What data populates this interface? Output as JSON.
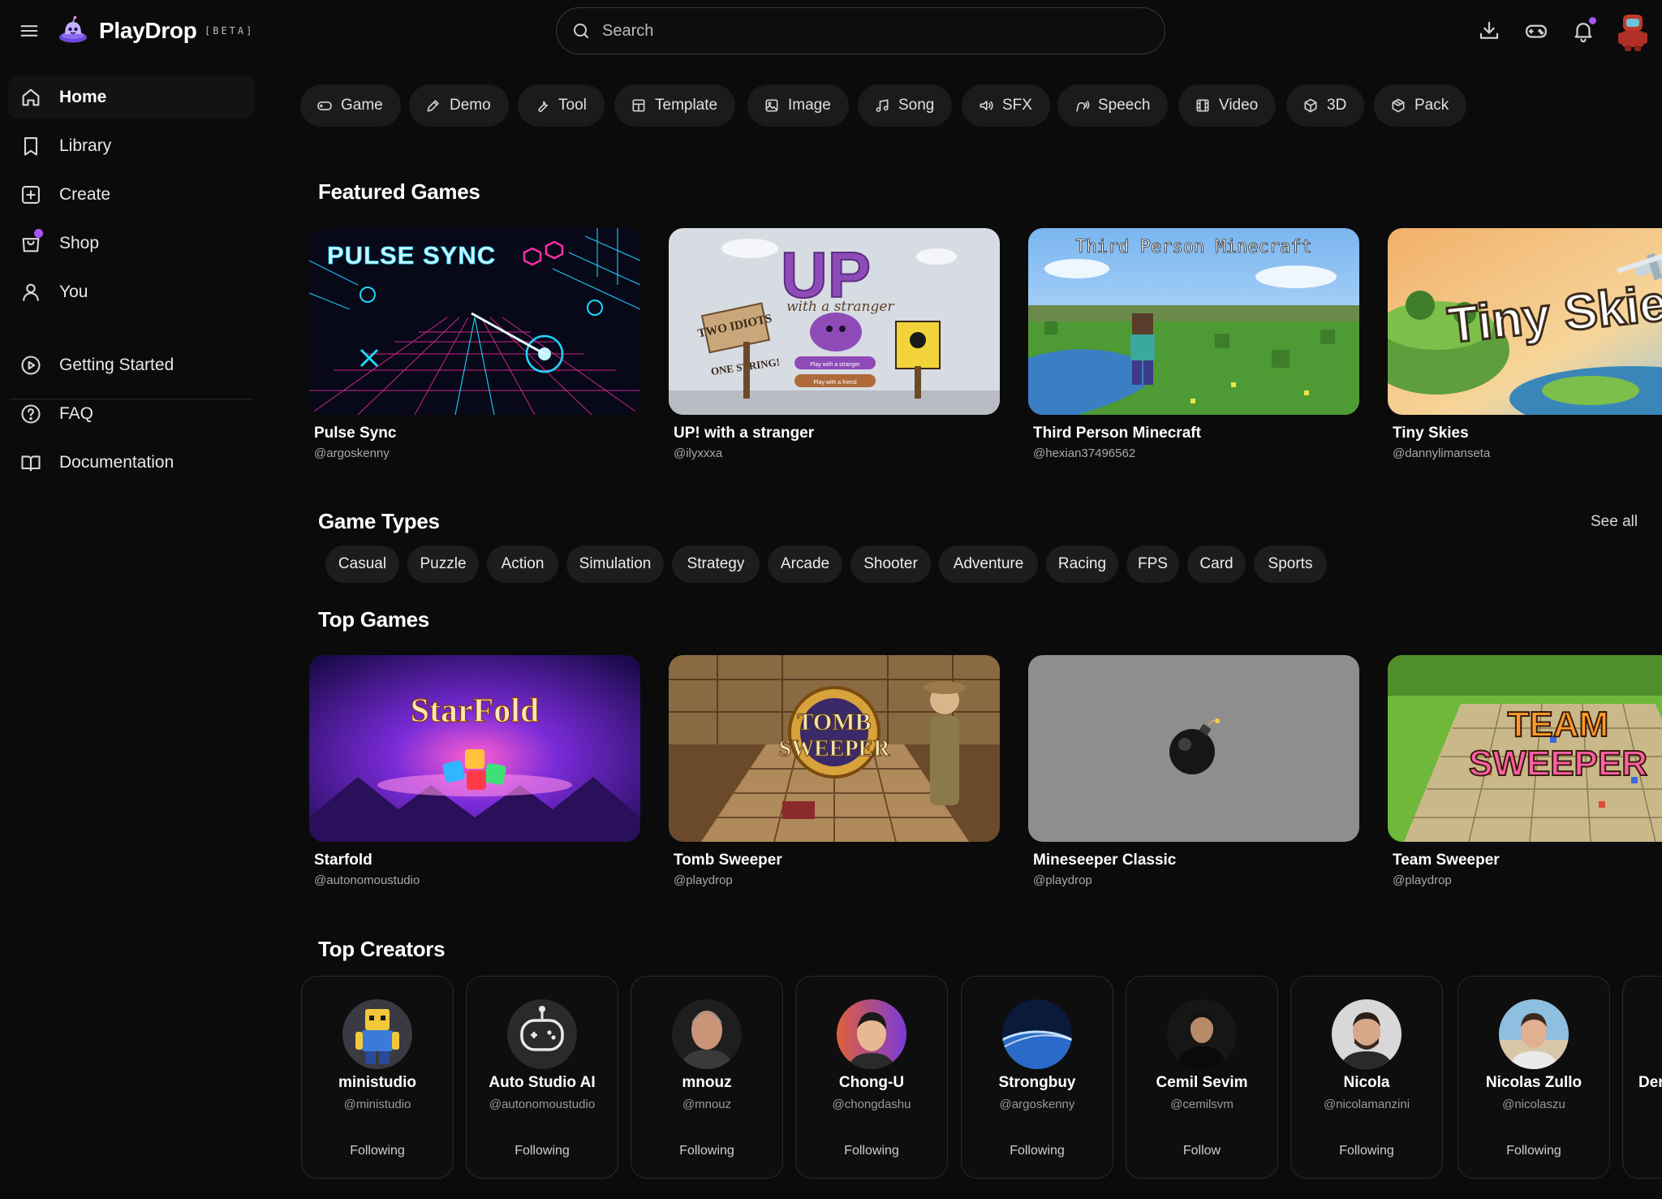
{
  "header": {
    "brand": "PlayDrop",
    "beta_label": "[BETA]",
    "search_placeholder": "Search",
    "icons": [
      "menu-icon",
      "download-icon",
      "gamepad-icon",
      "bell-icon",
      "avatar"
    ],
    "accent_color": "#a855f7"
  },
  "sidebar": {
    "primary": [
      {
        "label": "Home",
        "icon": "home-icon",
        "active": true
      },
      {
        "label": "Library",
        "icon": "bookmark-icon"
      },
      {
        "label": "Create",
        "icon": "plus-square-icon"
      },
      {
        "label": "Shop",
        "icon": "shopping-bag-icon"
      },
      {
        "label": "You",
        "icon": "user-icon"
      }
    ],
    "secondary": [
      {
        "label": "Getting Started",
        "icon": "play-circle-icon"
      },
      {
        "label": "FAQ",
        "icon": "help-circle-icon"
      },
      {
        "label": "Documentation",
        "icon": "book-open-icon"
      }
    ]
  },
  "categories": [
    {
      "label": "Game",
      "icon": "gamepad-icon"
    },
    {
      "label": "Demo",
      "icon": "pen-icon"
    },
    {
      "label": "Tool",
      "icon": "wrench-icon"
    },
    {
      "label": "Template",
      "icon": "layout-icon"
    },
    {
      "label": "Image",
      "icon": "image-icon"
    },
    {
      "label": "Song",
      "icon": "music-icon"
    },
    {
      "label": "SFX",
      "icon": "speaker-icon"
    },
    {
      "label": "Speech",
      "icon": "speech-icon"
    },
    {
      "label": "Video",
      "icon": "film-icon"
    },
    {
      "label": "3D",
      "icon": "cube-icon"
    },
    {
      "label": "Pack",
      "icon": "package-icon"
    }
  ],
  "featured": {
    "title": "Featured Games",
    "games": [
      {
        "title": "Pulse Sync",
        "author": "@argoskenny",
        "art_text": "PULSE SYNC"
      },
      {
        "title": "UP! with a stranger",
        "author": "@ilyxxxa",
        "art_text": "UP",
        "art_subtext": "with a stranger",
        "art_sign_left": "TWO IDIOTS",
        "art_sign_left2": "ONE STRING!",
        "art_btn1": "Play with a stranger",
        "art_btn2": "Play with a friend"
      },
      {
        "title": "Third Person Minecraft",
        "author": "@hexian37496562",
        "art_text": "Third Person Minecraft"
      },
      {
        "title": "Tiny Skies",
        "author": "@dannylimanseta",
        "art_text": "Tiny Skies"
      }
    ]
  },
  "game_types": {
    "title": "Game Types",
    "see_all": "See all",
    "types": [
      "Casual",
      "Puzzle",
      "Action",
      "Simulation",
      "Strategy",
      "Arcade",
      "Shooter",
      "Adventure",
      "Racing",
      "FPS",
      "Card",
      "Sports"
    ]
  },
  "top_games": {
    "title": "Top Games",
    "games": [
      {
        "title": "Starfold",
        "author": "@autonomoustudio",
        "art_text": "StarFold"
      },
      {
        "title": "Tomb Sweeper",
        "author": "@playdrop",
        "art_text": "TOMB",
        "art_text2": "SWEEPER"
      },
      {
        "title": "Mineseeper Classic",
        "author": "@playdrop"
      },
      {
        "title": "Team Sweeper",
        "author": "@playdrop",
        "art_text": "TEAM",
        "art_text2": "SWEEPER"
      }
    ]
  },
  "top_creators": {
    "title": "Top Creators",
    "creators": [
      {
        "name": "ministudio",
        "handle": "@ministudio",
        "status": "Following"
      },
      {
        "name": "Auto Studio AI",
        "handle": "@autonomoustudio",
        "status": "Following"
      },
      {
        "name": "mnouz",
        "handle": "@mnouz",
        "status": "Following"
      },
      {
        "name": "Chong-U",
        "handle": "@chongdashu",
        "status": "Following"
      },
      {
        "name": "Strongbuy",
        "handle": "@argoskenny",
        "status": "Following"
      },
      {
        "name": "Cemil Sevim",
        "handle": "@cemilsvm",
        "status": "Follow"
      },
      {
        "name": "Nicola",
        "handle": "@nicolamanzini",
        "status": "Following"
      },
      {
        "name": "Nicolas Zullo",
        "handle": "@nicolaszu",
        "status": "Following"
      },
      {
        "name": "Der",
        "handle": "",
        "status": ""
      }
    ]
  }
}
